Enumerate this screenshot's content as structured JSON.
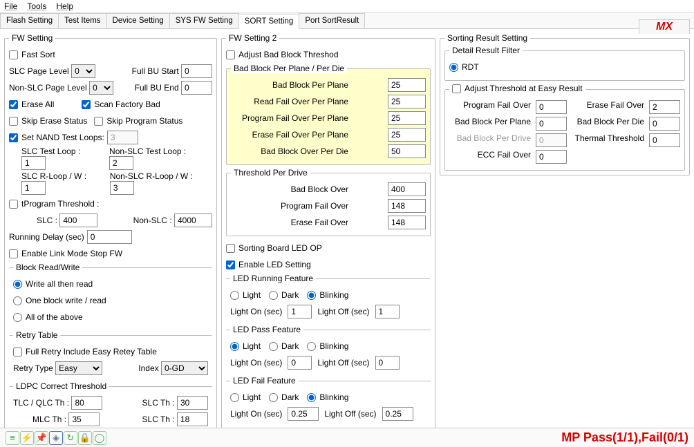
{
  "menu": {
    "file": "File",
    "tools": "Tools",
    "help": "Help"
  },
  "tabs": [
    "Flash Setting",
    "Test Items",
    "Device Setting",
    "SYS FW Setting",
    "SORT Setting",
    "Port SortResult"
  ],
  "active_tab": 4,
  "mx_label": "MX",
  "fw": {
    "legend": "FW Setting",
    "fast_sort": "Fast Sort",
    "slc_page_level_lbl": "SLC Page Level",
    "slc_page_level": "0",
    "full_bu_start_lbl": "Full BU Start",
    "full_bu_start": "0",
    "nonslc_page_level_lbl": "Non-SLC Page Level",
    "nonslc_page_level": "0",
    "full_bu_end_lbl": "Full BU End",
    "full_bu_end": "0",
    "erase_all": "Erase All",
    "scan_factory": "Scan Factory Bad",
    "skip_erase": "Skip Erase Status",
    "skip_program": "Skip Program Status",
    "set_nand_loops": "Set NAND Test Loops:",
    "nand_loops": "3",
    "slc_test_loop_lbl": "SLC Test Loop :",
    "slc_test_loop": "1",
    "nonslc_test_loop_lbl": "Non-SLC Test Loop :",
    "nonslc_test_loop": "2",
    "slc_rloop_lbl": "SLC R-Loop / W :",
    "slc_rloop": "1",
    "nonslc_rloop_lbl": "Non-SLC R-Loop / W :",
    "nonslc_rloop": "3",
    "tprog_thresh": "tProgram Threshold :",
    "slc_lbl": "SLC :",
    "slc_val": "400",
    "nonslc_lbl": "Non-SLC :",
    "nonslc_val": "4000",
    "running_delay_lbl": "Running Delay (sec)",
    "running_delay": "0",
    "enable_link": "Enable Link Mode Stop FW",
    "brw_legend": "Block Read/Write",
    "brw_opt1": "Write all then read",
    "brw_opt2": "One block write / read",
    "brw_opt3": "All of the above",
    "retry_legend": "Retry Table",
    "full_retry": "Full Retry Include Easy Retey Table",
    "retry_type_lbl": "Retry Type",
    "retry_type": "Easy",
    "index_lbl": "Index",
    "index": "0-GD",
    "ldpc_legend": "LDPC Correct Threshold",
    "tlc_th_lbl": "TLC / QLC Th :",
    "tlc_th": "80",
    "slc_th_lbl": "SLC Th :",
    "slc_th": "30",
    "mlc_th_lbl": "MLC Th :",
    "mlc_th": "35",
    "slc_th2": "18"
  },
  "fw2": {
    "legend": "FW Setting 2",
    "adjust_bb": "Adjust Bad Block Threshod",
    "bbpp_legend": "Bad Block Per Plane / Per Die",
    "bb_plane_lbl": "Bad Block Per Plane",
    "bb_plane": "25",
    "rf_plane_lbl": "Read Fail Over Per Plane",
    "rf_plane": "25",
    "pf_plane_lbl": "Program Fail Over Per Plane",
    "pf_plane": "25",
    "ef_plane_lbl": "Erase Fail Over Per Plane",
    "ef_plane": "25",
    "bb_die_lbl": "Bad Block Over Per Die",
    "bb_die": "50",
    "tpd_legend": "Threshold Per Drive",
    "bb_over_lbl": "Bad Block Over",
    "bb_over": "400",
    "pf_over_lbl": "Program Fail Over",
    "pf_over": "148",
    "ef_over_lbl": "Erase Fail Over",
    "ef_over": "148",
    "sorting_led": "Sorting Board LED OP",
    "enable_led": "Enable LED Setting",
    "run_legend": "LED Running Feature",
    "light": "Light",
    "dark": "Dark",
    "blinking": "Blinking",
    "light_on_lbl": "Light On (sec)",
    "light_off_lbl": "Light Off (sec)",
    "run_on": "1",
    "run_off": "1",
    "pass_legend": "LED Pass Feature",
    "pass_on": "0",
    "pass_off": "0",
    "fail_legend": "LED Fail Feature",
    "fail_on": "0.25",
    "fail_off": "0.25"
  },
  "sort": {
    "legend": "Sorting Result Setting",
    "drf_legend": "Detail Result Filter",
    "rdt": "RDT",
    "adjust_easy": "Adjust Threshold at Easy Result",
    "pf_over_lbl": "Program Fail Over",
    "pf_over": "0",
    "ef_over_lbl": "Erase Fail Over",
    "ef_over": "2",
    "bb_plane_lbl": "Bad Block  Per Plane",
    "bb_plane": "0",
    "bb_die_lbl": "Bad Block Per Die",
    "bb_die": "0",
    "bb_drive_lbl": "Bad Block Per Drive",
    "bb_drive": "0",
    "thermal_lbl": "Thermal Threshold",
    "thermal": "0",
    "ecc_lbl": "ECC Fail Over",
    "ecc": "0"
  },
  "status": "MP  Pass(1/1),Fail(0/1)"
}
